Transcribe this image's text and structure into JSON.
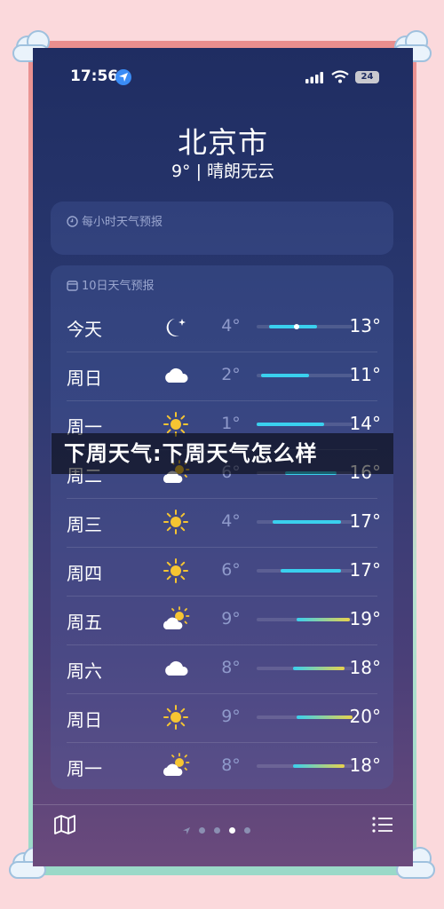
{
  "status_bar": {
    "time": "17:56",
    "battery": "24"
  },
  "location": {
    "city": "北京市",
    "summary": "9° | 晴朗无云"
  },
  "hourly": {
    "label": "每小时天气预报"
  },
  "forecast": {
    "label": "10日天气预报",
    "days": [
      {
        "day": "今天",
        "icon": "moon-star-icon",
        "low": "4°",
        "high": "13°",
        "range": [
          0.13,
          0.63
        ],
        "current": 0.42
      },
      {
        "day": "周日",
        "icon": "cloud-icon",
        "low": "2°",
        "high": "11°",
        "range": [
          0.05,
          0.55
        ]
      },
      {
        "day": "周一",
        "icon": "sun-icon",
        "low": "1°",
        "high": "14°",
        "range": [
          0.0,
          0.7
        ]
      },
      {
        "day": "周二",
        "icon": "partly-cloudy-icon",
        "low": "6°",
        "high": "16°",
        "range": [
          0.3,
          0.83
        ]
      },
      {
        "day": "周三",
        "icon": "sun-icon",
        "low": "4°",
        "high": "17°",
        "range": [
          0.17,
          0.88
        ]
      },
      {
        "day": "周四",
        "icon": "sun-icon",
        "low": "6°",
        "high": "17°",
        "range": [
          0.25,
          0.88
        ]
      },
      {
        "day": "周五",
        "icon": "partly-cloudy-icon",
        "low": "9°",
        "high": "19°",
        "range": [
          0.42,
          0.97
        ]
      },
      {
        "day": "周六",
        "icon": "cloud-icon",
        "low": "8°",
        "high": "18°",
        "range": [
          0.38,
          0.92
        ]
      },
      {
        "day": "周日",
        "icon": "sun-icon",
        "low": "9°",
        "high": "20°",
        "range": [
          0.42,
          1.0
        ]
      },
      {
        "day": "周一",
        "icon": "partly-cloudy-icon",
        "low": "8°",
        "high": "18°",
        "range": [
          0.38,
          0.92
        ]
      }
    ]
  },
  "overlay": {
    "title": "下周天气:下周天气怎么样"
  },
  "colors": {
    "accent": "#3a8cf6",
    "cold": "#3ad0ee",
    "warm": "#e8d24c",
    "sun": "#f6c532"
  }
}
